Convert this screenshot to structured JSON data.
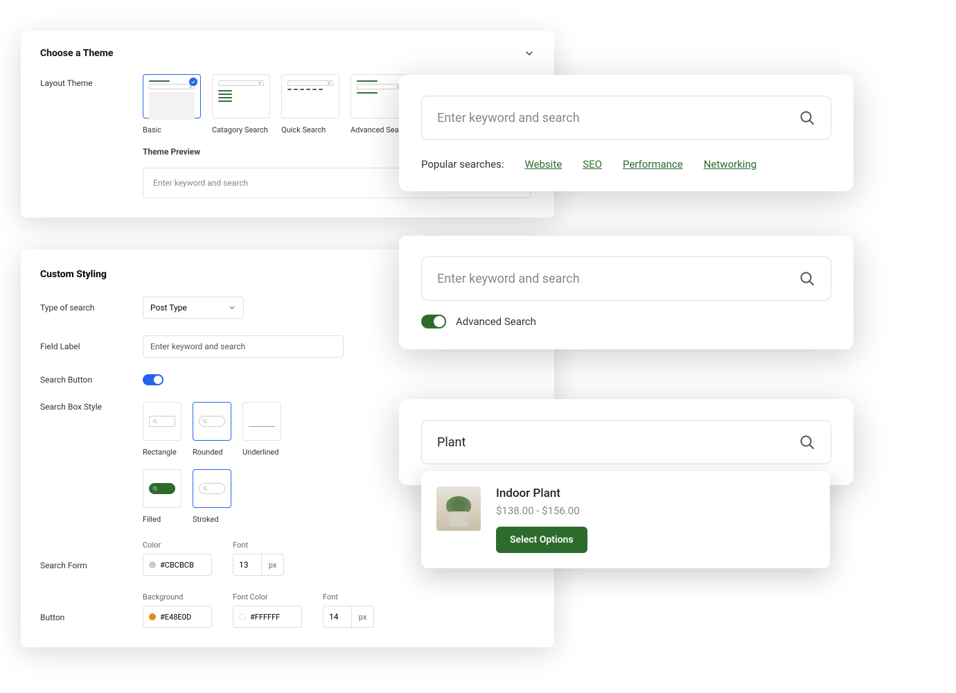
{
  "themePanel": {
    "title": "Choose a Theme",
    "layoutLabel": "Layout Theme",
    "themes": [
      {
        "name": "Basic",
        "selected": true
      },
      {
        "name": "Catagory Search",
        "selected": false
      },
      {
        "name": "Quick Search",
        "selected": false
      },
      {
        "name": "Advanced Search",
        "selected": false
      }
    ],
    "previewLabel": "Theme Preview",
    "previewPlaceholder": "Enter keyword and search"
  },
  "stylePanel": {
    "title": "Custom Styling",
    "typeLabel": "Type of search",
    "typeValue": "Post Type",
    "fieldLabel": "Field Label",
    "fieldValue": "Enter keyword and search",
    "searchButtonLabel": "Search Button",
    "boxStyleLabel": "Search Box Style",
    "boxStyles": [
      "Rectangle",
      "Rounded",
      "Underlined"
    ],
    "btnStyles": [
      "Filled",
      "Stroked"
    ],
    "searchFormLabel": "Search Form",
    "buttonLabel": "Button",
    "colorLabel": "Color",
    "fontLabel": "Font",
    "bgLabel": "Background",
    "fontColorLabel": "Font Color",
    "formColor": "#CBCBCB",
    "formFont": "13",
    "btnBg": "#E48E0D",
    "btnFontColor": "#FFFFFF",
    "btnFont": "14",
    "px": "px"
  },
  "preview1": {
    "placeholder": "Enter keyword and search",
    "popularLabel": "Popular searches:",
    "popularLinks": [
      "Website",
      "SEO",
      "Performance",
      "Networking"
    ]
  },
  "preview2": {
    "placeholder": "Enter keyword and search",
    "advLabel": "Advanced Search"
  },
  "preview3": {
    "query": "Plant",
    "result": {
      "title": "Indoor Plant",
      "price": "$138.00 - $156.00",
      "cta": "Select Options"
    }
  }
}
